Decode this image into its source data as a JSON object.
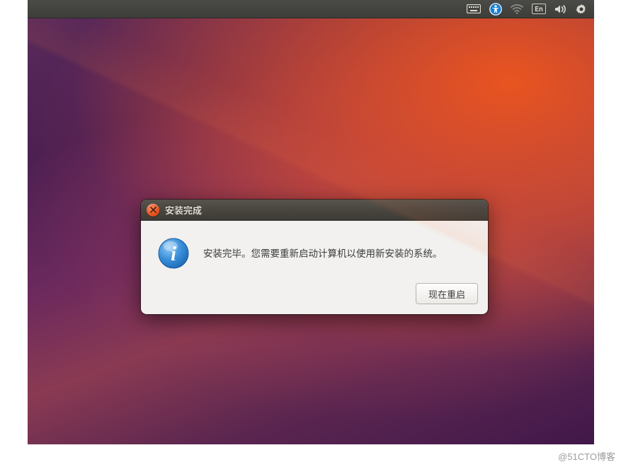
{
  "topbar": {
    "language_badge": "En"
  },
  "dialog": {
    "title": "安装完成",
    "message": "安装完毕。您需要重新启动计算机以使用新安装的系统。",
    "restart_button_label": "现在重启"
  },
  "watermark": "@51CTO博客"
}
